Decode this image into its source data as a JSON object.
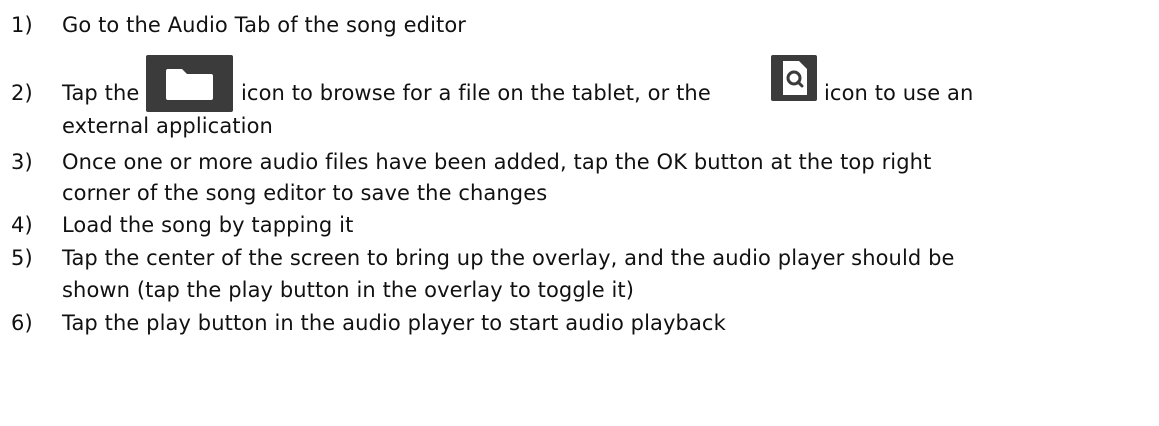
{
  "steps": [
    {
      "number": "1)",
      "lines": [
        "Go to the Audio Tab of the song editor"
      ]
    },
    {
      "number": "2)",
      "segments": [
        "Tap the",
        "icon to browse for a file on the tablet, or the",
        "icon to use an"
      ],
      "lines": [
        "external application"
      ],
      "icons": [
        "folder-icon",
        "search-file-icon"
      ]
    },
    {
      "number": "3)",
      "lines": [
        "Once one or more audio files have been added, tap the OK button at the top right",
        "corner of the song editor to save the changes"
      ]
    },
    {
      "number": "4)",
      "lines": [
        "Load the song by tapping it"
      ]
    },
    {
      "number": "5)",
      "lines": [
        "Tap the center of the screen to bring up the overlay, and the audio player should be",
        "shown (tap the play button in the overlay to toggle it)"
      ]
    },
    {
      "number": "6)",
      "lines": [
        "Tap the play button in the audio player to start audio playback"
      ]
    }
  ]
}
